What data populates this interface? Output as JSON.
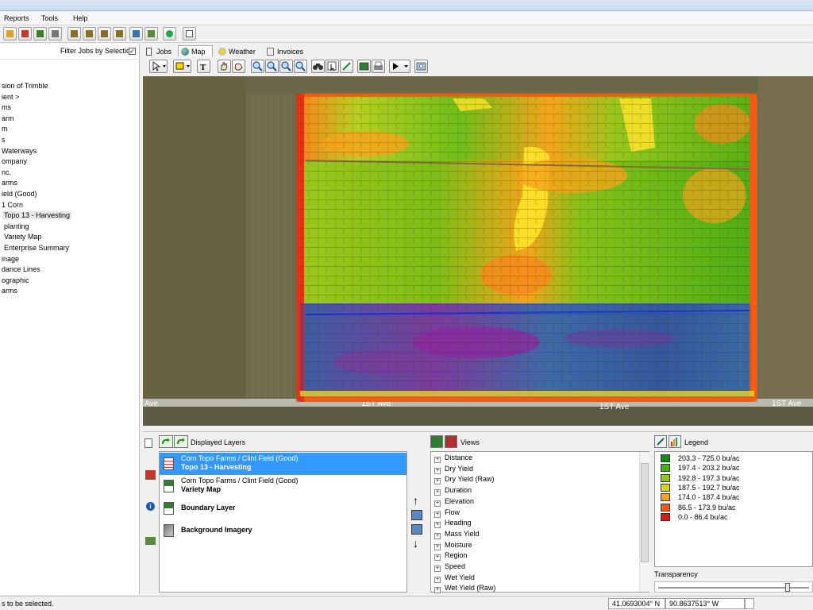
{
  "menu": [
    "Reports",
    "Tools",
    "Help"
  ],
  "left_pane": {
    "filter_label": "Filter Jobs by Selection",
    "filter_checked": "✓",
    "tree": [
      "sion of Trimble",
      "ient >",
      "ms",
      "arm",
      "m",
      "s",
      "Waterways",
      "ompany",
      "nc.",
      "arms",
      "ield (Good)",
      "1 Corn",
      "Topo 13 - Harvesting",
      "planting",
      "Variety Map",
      "Enterprise Summary",
      "inage",
      "dance Lines",
      "ographic",
      "arms"
    ]
  },
  "tabs": [
    {
      "label": "Jobs",
      "icon": "jobs-icon"
    },
    {
      "label": "Map",
      "icon": "globe-icon"
    },
    {
      "label": "Weather",
      "icon": "weather-icon"
    },
    {
      "label": "Invoices",
      "icon": "invoice-icon"
    }
  ],
  "map": {
    "road_labels": [
      "Ave",
      "1ST Ave",
      "1ST Ave",
      "1ST Ave"
    ]
  },
  "layers_panel": {
    "title": "Displayed Layers",
    "items": [
      {
        "line1": "Corn Topo Farms / Clint Field (Good)",
        "line2": "Topo 13 - Harvesting"
      },
      {
        "line1": "Corn Topo Farms / Clint Field (Good)",
        "line2": "Variety Map"
      },
      {
        "line1": "",
        "line2": "Boundary Layer"
      },
      {
        "line1": "",
        "line2": "Background Imagery"
      }
    ]
  },
  "views_panel": {
    "title": "Views",
    "items": [
      "Distance",
      "Dry Yield",
      "Dry Yield (Raw)",
      "Duration",
      "Elevation",
      "Flow",
      "Heading",
      "Mass Yield",
      "Moisture",
      "Region",
      "Speed",
      "Wet Yield",
      "Wet Yield (Raw)"
    ],
    "expander": "+"
  },
  "legend_panel": {
    "title": "Legend",
    "transparency_label": "Transparency",
    "items": [
      {
        "label": "203.3 - 725.0 bu/ac",
        "color": "#138a13"
      },
      {
        "label": "197.4 - 203.2 bu/ac",
        "color": "#4fad16"
      },
      {
        "label": "192.8 - 197.3 bu/ac",
        "color": "#94c61c"
      },
      {
        "label": "187.5 - 192.7 bu/ac",
        "color": "#d4d623"
      },
      {
        "label": "174.0 - 187.4 bu/ac",
        "color": "#f4a41c"
      },
      {
        "label": "86.5 - 173.9 bu/ac",
        "color": "#f25b14"
      },
      {
        "label": "0.0 - 86.4 bu/ac",
        "color": "#e01616"
      }
    ]
  },
  "status": {
    "message": "s to be selected.",
    "latitude": "41.0693004° N",
    "longitude": "90.8637513° W"
  }
}
